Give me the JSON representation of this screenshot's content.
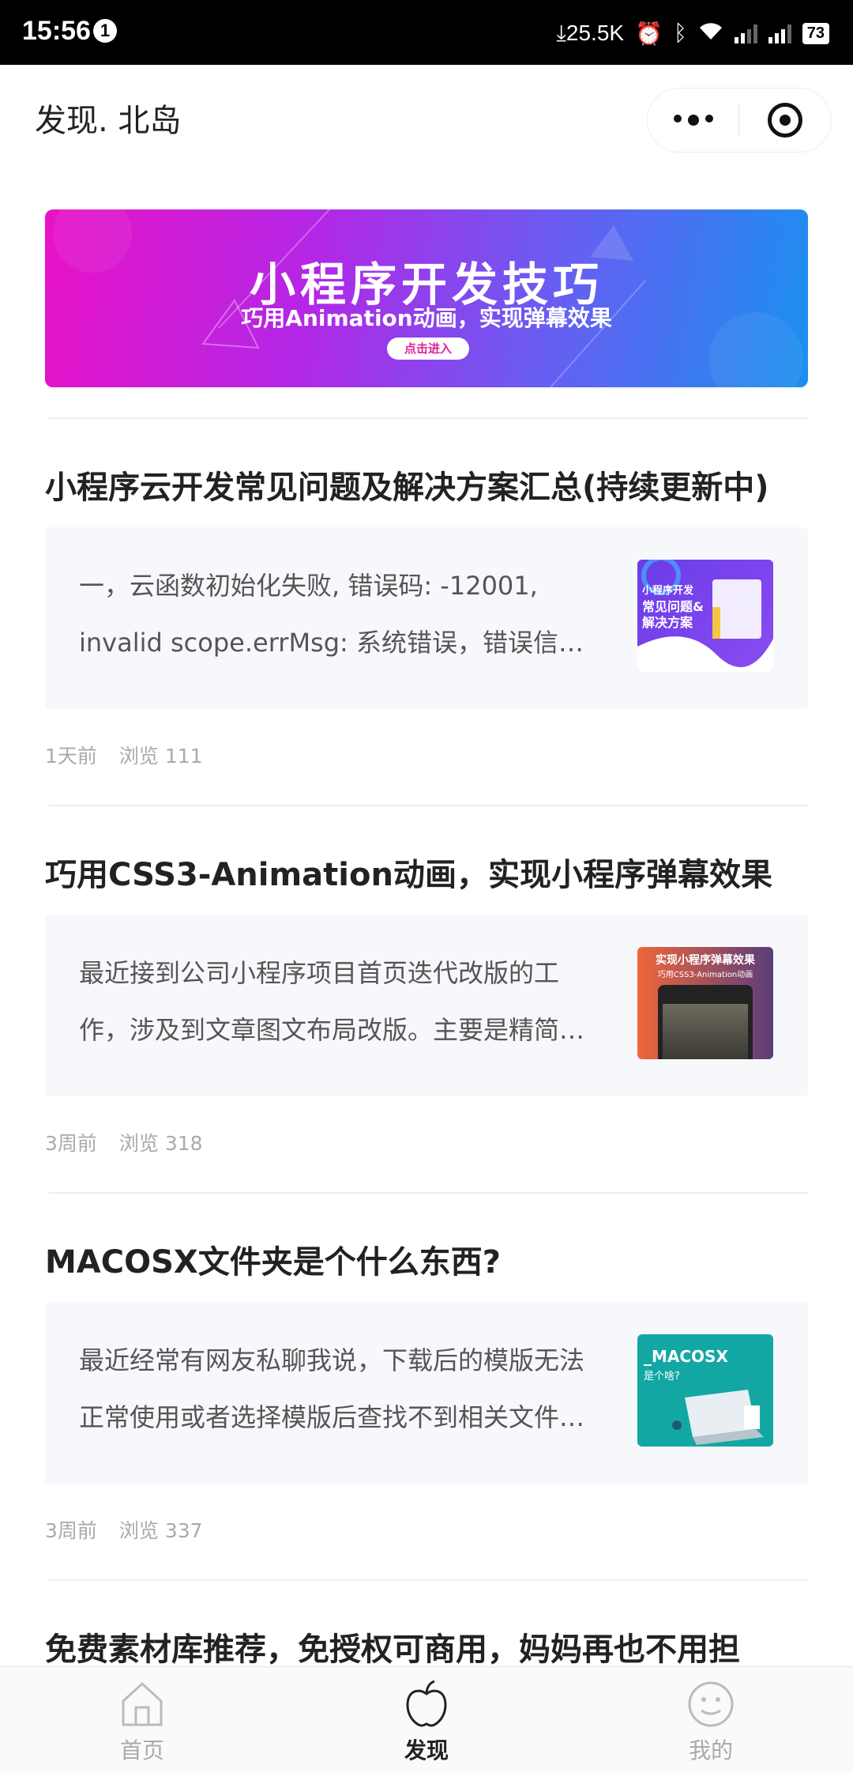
{
  "status_bar": {
    "time": "15:56",
    "notification_count": "1",
    "net_speed": "25.5K",
    "battery": "73"
  },
  "nav": {
    "title": "发现. 北岛"
  },
  "banner": {
    "title": "小程序开发技巧",
    "subtitle": "巧用Animation动画，实现弹幕效果",
    "button": "点击进入"
  },
  "articles": [
    {
      "title": "小程序云开发常见问题及解决方案汇总(持续更新中)",
      "excerpt": "一，云函数初始化失败, 错误码: -12001, invalid scope.errMsg: 系统错误，错误信息: invalid scope 没有权限，请先开通云服务",
      "thumb_text": [
        "小程序开发",
        "常见问题&",
        "解决方案"
      ],
      "time": "1天前",
      "views": "浏览 111"
    },
    {
      "title": "巧用CSS3-Animation动画，实现小程序弹幕效果",
      "excerpt": "最近接到公司小程序项目首页迭代改版的工作，涉及到文章图文布局改版。主要是精简首页内容，突出重点",
      "thumb_text": [
        "实现小程序弹幕效果",
        "巧用CSS3-Animation动画"
      ],
      "time": "3周前",
      "views": "浏览 318"
    },
    {
      "title": "MACOSX文件夹是个什么东西?",
      "excerpt": "最近经常有网友私聊我说，下载后的模版无法正常使用或者选择模版后查找不到相关文件，这是怎么回事",
      "thumb_text": [
        "_MACOSX",
        "是个啥?"
      ],
      "time": "3周前",
      "views": "浏览 337"
    },
    {
      "title": "免费素材库推荐，免授权可商用，妈妈再也不用担"
    }
  ],
  "tabbar": {
    "items": [
      {
        "label": "首页",
        "icon": "home-icon",
        "active": false
      },
      {
        "label": "发现",
        "icon": "apple-icon",
        "active": true
      },
      {
        "label": "我的",
        "icon": "smiley-icon",
        "active": false
      }
    ]
  }
}
